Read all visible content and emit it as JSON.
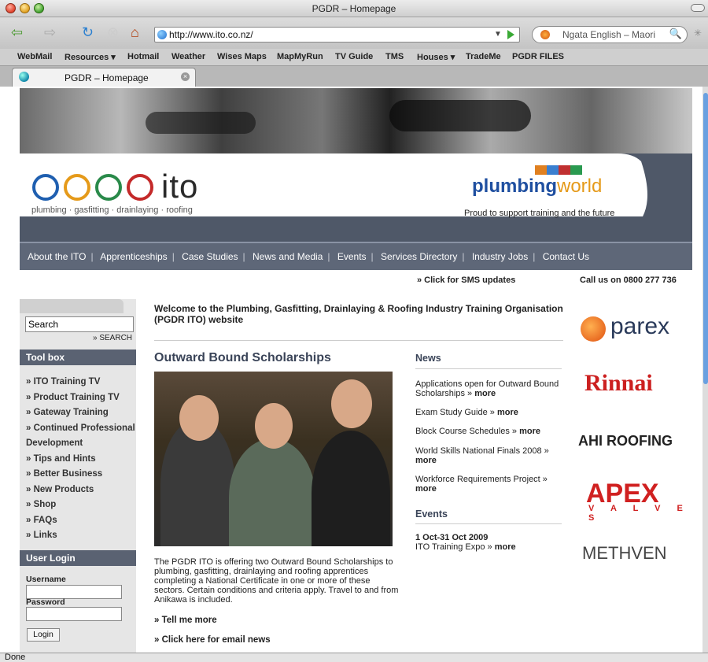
{
  "window": {
    "title": "PGDR – Homepage"
  },
  "toolbar": {
    "url": "http://www.ito.co.nz/",
    "search_engine": "Ngata English – Maori"
  },
  "bookmarks": [
    "WebMail",
    "Resources ▾",
    "Hotmail",
    "Weather",
    "Wises Maps",
    "MapMyRun",
    "TV Guide",
    "TMS",
    "Houses ▾",
    "TradeMe",
    "PGDR FILES"
  ],
  "tab": {
    "label": "PGDR – Homepage"
  },
  "status": "Done",
  "site": {
    "logo_text": "ito",
    "tagline": "plumbing · gasfitting · drainlaying · roofing",
    "sponsor_brand": "plumbing",
    "sponsor_brand2": "world",
    "sponsor_tagline": "Proud to support training and the future",
    "nav": [
      "About the ITO",
      "Apprenticeships",
      "Case Studies",
      "News and Media",
      "Events",
      "Services Directory",
      "Industry Jobs",
      "Contact Us"
    ],
    "sms": "» Click for SMS updates",
    "call": "Call us on 0800 277 736"
  },
  "sidebar": {
    "search_value": "Search",
    "search_button": "» SEARCH",
    "toolbox_title": "Tool box",
    "tools": [
      "» ITO Training TV",
      "» Product Training TV",
      "» Gateway Training",
      "» Continued Professional Development",
      "» Tips and Hints",
      "» Better Business",
      "» New Products",
      "» Shop",
      "» FAQs",
      "» Links"
    ],
    "login_title": "User Login",
    "username_label": "Username",
    "password_label": "Password",
    "login_button": "Login"
  },
  "main": {
    "welcome": "Welcome to the Plumbing, Gasfitting, Drainlaying & Roofing Industry Training Organisation (PGDR ITO) website",
    "ob_title": "Outward Bound Scholarships",
    "ob_desc": "The PGDR ITO is offering two Outward Bound Scholarships to plumbing, gasfitting, drainlaying and roofing apprentices completing a National Certificate in one or more of these sectors.  Certain conditions and criteria apply.  Travel to and from Anikawa is included.",
    "link_tell": "»  Tell me more",
    "link_email": "»  Click here for email news"
  },
  "news": {
    "title": "News",
    "items": [
      {
        "text": "Applications open for Outward Bound Scholarships »",
        "more": "more"
      },
      {
        "text": "Exam Study Guide »",
        "more": "more"
      },
      {
        "text": "Block Course Schedules »",
        "more": "more"
      },
      {
        "text": "World Skills National Finals 2008 »",
        "more": "more"
      },
      {
        "text": "Workforce Requirements Project »",
        "more": "more"
      }
    ]
  },
  "events": {
    "title": "Events",
    "date": "1 Oct-31 Oct 2009",
    "text": "ITO Training Expo »",
    "more": "more"
  },
  "sponsors": [
    "parex",
    "Rinnai",
    "AHI ROOFING",
    "APEX",
    "V A L V E S",
    "METHVEN"
  ]
}
